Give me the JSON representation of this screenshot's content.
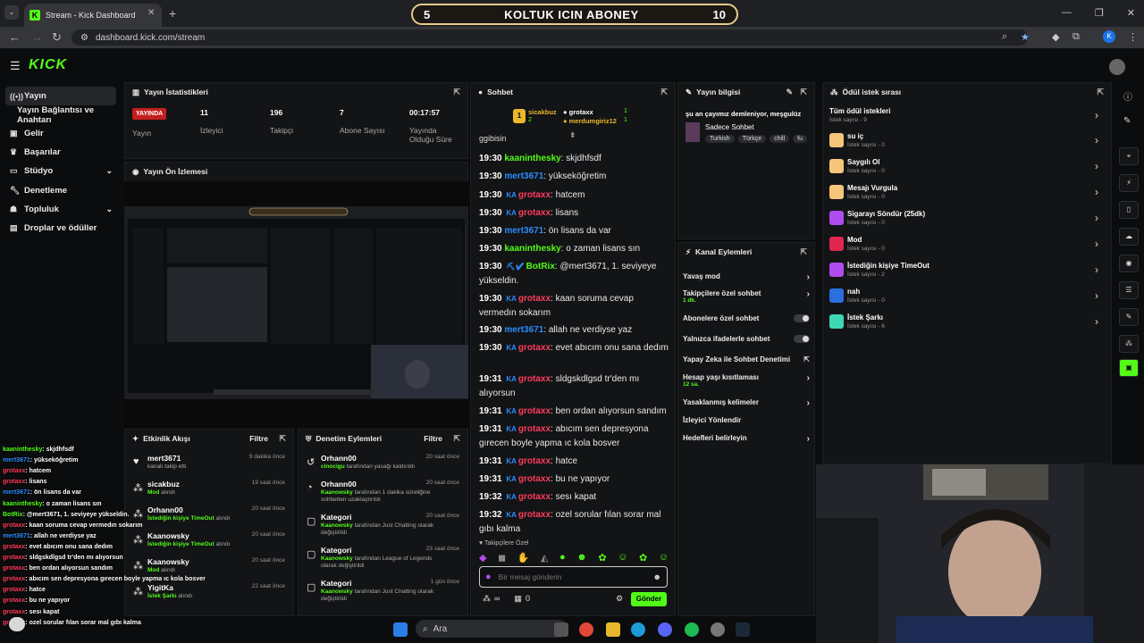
{
  "browser": {
    "tab_title": "Stream - Kick Dashboard",
    "url": "dashboard.kick.com/stream",
    "profile_initial": "K"
  },
  "overlay_banner": {
    "left_num": "5",
    "title": "KOLTUK ICIN ABONEY",
    "right_num": "10"
  },
  "sidebar": {
    "items": [
      {
        "label": "Yayın"
      },
      {
        "label": "Yayın Bağlantısı ve Anahtarı"
      },
      {
        "label": "Gelir"
      },
      {
        "label": "Başarılar"
      },
      {
        "label": "Stüdyo"
      },
      {
        "label": "Denetleme"
      },
      {
        "label": "Topluluk"
      },
      {
        "label": "Droplar ve ödüller"
      }
    ]
  },
  "stats": {
    "title": "Yayın İstatistikleri",
    "live_badge": "YAYINDA",
    "live_label": "Yayın",
    "viewers": "11",
    "viewers_label": "İzleyici",
    "followers": "196",
    "followers_label": "Takipçi",
    "subs": "7",
    "subs_label": "Abone Sayısı",
    "uptime": "00:17:57",
    "uptime_label": "Yayında Olduğu Süre"
  },
  "preview": {
    "title": "Yayın Ön İzlemesi"
  },
  "activity": {
    "title": "Etkinlik Akışı",
    "filter": "Filtre",
    "events": [
      {
        "name": "mert3671",
        "sub": "kanalı takip etti",
        "sub_green": "",
        "time": "9 dakika önce"
      },
      {
        "name": "sicakbuz",
        "sub": "alındı",
        "sub_green": "Mod",
        "time": "19 saat önce"
      },
      {
        "name": "Orhann00",
        "sub": "alındı",
        "sub_green": "İstediğin kişiye TimeOut",
        "time": "20 saat önce"
      },
      {
        "name": "Kaanowsky",
        "sub": "alındı",
        "sub_green": "İstediğin kişiye TimeOut",
        "time": "20 saat önce"
      },
      {
        "name": "Kaanowsky",
        "sub": "alındı",
        "sub_green": "Mod",
        "time": "20 saat önce"
      },
      {
        "name": "YigitKa",
        "sub": "alındı",
        "sub_green": "İstek Şarkı",
        "time": "22 saat önce"
      }
    ]
  },
  "moderation": {
    "title": "Denetim Eylemleri",
    "filter": "Filtre",
    "items": [
      {
        "name": "Orhann00",
        "actor": "cinocigu",
        "text": "tarafından yasağı kaldırıldı",
        "time": "20 saat önce"
      },
      {
        "name": "Orhann00",
        "actor": "Kaanowsky",
        "text": "tarafından 1 dakika süreliğine sohbetten uzaklaştırıldı",
        "time": "20 saat önce"
      },
      {
        "name": "Kategori",
        "actor": "Kaanowsky",
        "text": "tarafından Just Chatting olarak değiştirildi",
        "time": "20 saat önce"
      },
      {
        "name": "Kategori",
        "actor": "Kaanowsky",
        "text": "tarafından League of Legends olarak değiştirildi",
        "time": "23 saat önce"
      },
      {
        "name": "Kategori",
        "actor": "Kaanowsky",
        "text": "tarafından Just Chatting olarak değiştirildi",
        "time": "1 gün önce"
      }
    ]
  },
  "chat": {
    "title": "Sohbet",
    "top_gifters": [
      {
        "name": "sicakbuz",
        "count": "2"
      },
      {
        "name": "grotaxx",
        "count": "1"
      },
      {
        "name": "merdumgiriz12",
        "count": "1"
      }
    ],
    "partial_top": "ggibisin",
    "messages": [
      {
        "time": "19:30",
        "user": "kaaninthesky",
        "color": "#53fc18",
        "badge": "",
        "text": "skjdhfsdf"
      },
      {
        "time": "19:30",
        "user": "mert3671",
        "color": "#2b8cff",
        "badge": "",
        "text": "yükseköğretim"
      },
      {
        "time": "19:30",
        "user": "grotaxx",
        "color": "#ff3b5c",
        "badge": "KA",
        "text": "hatcem"
      },
      {
        "time": "19:30",
        "user": "grotaxx",
        "color": "#ff3b5c",
        "badge": "KA",
        "text": "lisans"
      },
      {
        "time": "19:30",
        "user": "mert3671",
        "color": "#2b8cff",
        "badge": "",
        "text": "ön lisans da var"
      },
      {
        "time": "19:30",
        "user": "kaaninthesky",
        "color": "#53fc18",
        "badge": "",
        "text": "o zaman lisans sın"
      },
      {
        "time": "19:30",
        "user": "BotRix",
        "color": "#53fc18",
        "badge": "",
        "text": "@mert3671, 1. seviyeye yükseldin."
      },
      {
        "time": "19:30",
        "user": "grotaxx",
        "color": "#ff3b5c",
        "badge": "KA",
        "text": "kaan soruma cevap vermedın sokarım"
      },
      {
        "time": "19:30",
        "user": "mert3671",
        "color": "#2b8cff",
        "badge": "",
        "text": "allah ne verdiyse yaz"
      },
      {
        "time": "19:30",
        "user": "grotaxx",
        "color": "#ff3b5c",
        "badge": "KA",
        "text": "evet abıcım onu sana dedım"
      },
      {
        "time": "19:31",
        "user": "grotaxx",
        "color": "#ff3b5c",
        "badge": "KA",
        "text": "sldgskdlgsd tr'den mı alıyorsun"
      },
      {
        "time": "19:31",
        "user": "grotaxx",
        "color": "#ff3b5c",
        "badge": "KA",
        "text": "ben ordan alıyorsun sandım"
      },
      {
        "time": "19:31",
        "user": "grotaxx",
        "color": "#ff3b5c",
        "badge": "KA",
        "text": "abıcım sen depresyona gırecen boyle yapma ıc kola bosver"
      },
      {
        "time": "19:31",
        "user": "grotaxx",
        "color": "#ff3b5c",
        "badge": "KA",
        "text": "hatce"
      },
      {
        "time": "19:31",
        "user": "grotaxx",
        "color": "#ff3b5c",
        "badge": "KA",
        "text": "bu ne yapıyor"
      },
      {
        "time": "19:32",
        "user": "grotaxx",
        "color": "#ff3b5c",
        "badge": "KA",
        "text": "sesı kapat"
      },
      {
        "time": "19:32",
        "user": "grotaxx",
        "color": "#ff3b5c",
        "badge": "KA",
        "text": "ozel sorular fılan sorar mal gıbı kalma"
      }
    ],
    "followers_only_label": "Takipçilere Özel",
    "input_placeholder": "Bir mesaj gönderin",
    "infinity": "∞",
    "points": "0",
    "send_label": "Gönder"
  },
  "stream_info": {
    "title": "Yayın bilgisi",
    "stream_title": "şu an çayımız demleniyor, meşgulüz",
    "category": "Sadece Sohbet",
    "tags": [
      "Turkish",
      "Türkçe",
      "chill",
      "fu"
    ]
  },
  "channel_actions": {
    "title": "Kanal Eylemleri",
    "items": [
      {
        "label": "Yavaş mod",
        "sub": ""
      },
      {
        "label": "Takipçilere özel sohbet",
        "sub": "1 dk."
      },
      {
        "label": "Abonelere özel sohbet",
        "sub": ""
      },
      {
        "label": "Yalnızca ifadelerle sohbet",
        "sub": ""
      },
      {
        "label": "Yapay Zeka ile Sohbet Denetimi",
        "sub": ""
      },
      {
        "label": "Hesap yaşı kısıtlaması",
        "sub": "12 sa."
      },
      {
        "label": "Yasaklanmış kelimeler",
        "sub": ""
      },
      {
        "label": "İzleyici Yönlendir",
        "sub": ""
      },
      {
        "label": "Hedefleri belirleyin",
        "sub": ""
      }
    ]
  },
  "rewards": {
    "title": "Ödül istek sırası",
    "all_label": "Tüm ödül istekleri",
    "all_sub": "İstek sayısı - 9",
    "items": [
      {
        "name": "su iç",
        "sub": "İstek sayısı - 0",
        "color": "#f5c57a"
      },
      {
        "name": "Saygılı Ol",
        "sub": "İstek sayısı - 0",
        "color": "#f5c57a"
      },
      {
        "name": "Mesajı Vurgula",
        "sub": "İstek sayısı - 0",
        "color": "#f5c57a"
      },
      {
        "name": "Sigarayı Söndür (25dk)",
        "sub": "İstek sayısı - 0",
        "color": "#b04cf0"
      },
      {
        "name": "Mod",
        "sub": "İstek sayısı - 0",
        "color": "#e0264e"
      },
      {
        "name": "İstediğin kişiye TimeOut",
        "sub": "İstek sayısı - 2",
        "color": "#b04cf0"
      },
      {
        "name": "nah",
        "sub": "İstek sayısı - 0",
        "color": "#2a6fe0"
      },
      {
        "name": "İstek Şarkı",
        "sub": "İstek sayısı - 6",
        "color": "#3ed6b5"
      }
    ]
  },
  "overlay_chat": [
    {
      "user": "kaaninthesky",
      "color": "#53fc18",
      "text": ": skjdhfsdf"
    },
    {
      "user": "mert3671",
      "color": "#2b8cff",
      "text": ": yükseköğretim"
    },
    {
      "user": "grotaxx",
      "color": "#ff3b5c",
      "text": ": hatcem"
    },
    {
      "user": "grotaxx",
      "color": "#ff3b5c",
      "text": ": lisans"
    },
    {
      "user": "mert3671",
      "color": "#2b8cff",
      "text": ": ön lisans da var"
    },
    {
      "user": "kaaninthesky",
      "color": "#53fc18",
      "text": ": o zaman lisans sın"
    },
    {
      "user": "BotRix",
      "color": "#53fc18",
      "text": ": @mert3671, 1. seviyeye yükseldin."
    },
    {
      "user": "grotaxx",
      "color": "#ff3b5c",
      "text": ": kaan soruma cevap vermedın sokarım"
    },
    {
      "user": "mert3671",
      "color": "#2b8cff",
      "text": ": allah ne verdiyse yaz"
    },
    {
      "user": "grotaxx",
      "color": "#ff3b5c",
      "text": ": evet abıcım onu sana dedım"
    },
    {
      "user": "grotaxx",
      "color": "#ff3b5c",
      "text": ": sldgskdlgsd tr'den mı alıyorsun"
    },
    {
      "user": "grotaxx",
      "color": "#ff3b5c",
      "text": ": ben ordan alıyorsun sandım"
    },
    {
      "user": "grotaxx",
      "color": "#ff3b5c",
      "text": ": abıcım sen depresyona gırecen boyle yapma ıc kola bosver"
    },
    {
      "user": "grotaxx",
      "color": "#ff3b5c",
      "text": ": hatce"
    },
    {
      "user": "grotaxx",
      "color": "#ff3b5c",
      "text": ": bu ne yapıyor"
    },
    {
      "user": "grotaxx",
      "color": "#ff3b5c",
      "text": ": sesı kapat"
    },
    {
      "user": "grotaxx",
      "color": "#ff3b5c",
      "text": ": ozel sorular fılan sorar mal gıbı kalma"
    }
  ],
  "taskbar": {
    "search_label": "Ara"
  }
}
